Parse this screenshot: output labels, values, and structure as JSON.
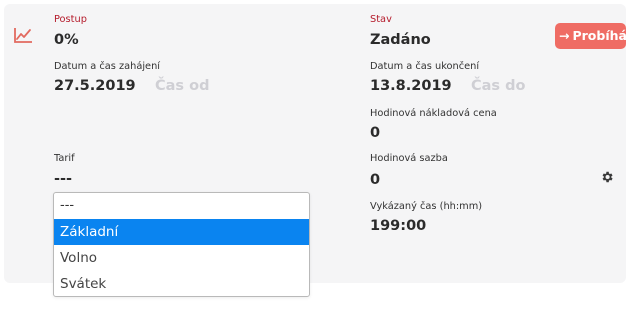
{
  "progress": {
    "label": "Postup",
    "value": "0%"
  },
  "state": {
    "label": "Stav",
    "value": "Zadáno"
  },
  "status_button": {
    "arrow": "→",
    "label": "Probíhá"
  },
  "start": {
    "label": "Datum a čas zahájení",
    "date": "27.5.2019",
    "time_placeholder": "Čas od"
  },
  "end": {
    "label": "Datum a čas ukončení",
    "date": "13.8.2019",
    "time_placeholder": "Čas do"
  },
  "hourly_cost": {
    "label": "Hodinová nákladová cena",
    "value": "0"
  },
  "tariff": {
    "label": "Tarif",
    "value": "---",
    "dropdown": {
      "search_value": "---",
      "options": [
        "Základní",
        "Volno",
        "Svátek"
      ],
      "selected_index": 0
    }
  },
  "hourly_rate": {
    "label": "Hodinová sazba",
    "value": "0"
  },
  "reported_time": {
    "label": "Vykázaný čas (hh:mm)",
    "value": "199:00"
  },
  "colors": {
    "accent_red": "#b51c2c",
    "status_pill": "#ef6c64",
    "selected_option": "#0a84f0",
    "panel_bg": "#f5f5f6"
  },
  "icons": {
    "chart": "line-chart-icon",
    "settings": "gear-icon",
    "status_arrow": "arrow-right-icon"
  }
}
